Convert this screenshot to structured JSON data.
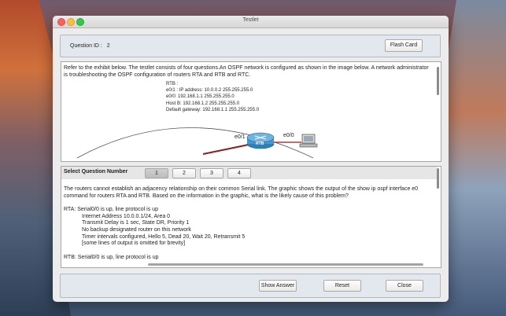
{
  "window": {
    "title": "Testlet"
  },
  "header": {
    "question_id_label": "Question ID :",
    "question_id": "2",
    "flash_card_label": "Flash Card"
  },
  "exhibit": {
    "intro": "Refer to the exhibit below. The testlet consists of four questions.An OSPF network is configured as shown in the image below. A network administrator is troubleshooting the OSPF configuration of routers RTA and RTB and RTC.",
    "info": [
      "RTB :",
      "e0/1 : IP address: 10.0.0.2 255.255.255.0",
      "e0/0: 192.168.1.1 255.255.255.0",
      "Host B: 192.168.1.2 255.255.255.0",
      "Default gateway: 192.168.1.1 255.255.255.0"
    ],
    "port_left": "e0/1",
    "port_right": "e0/0",
    "router_label": "RTB"
  },
  "question": {
    "select_label": "Select Question Number",
    "numbers": [
      "1",
      "2",
      "3",
      "4"
    ],
    "selected": "1",
    "text": "The routers cannot establish an adjacency relationship on their common Serial link. The graphic shows the output of the show ip ospf interface e0 command for routers RTA and RTB. Based on the information in the graphic, what is the likely cause of this problem?",
    "rta_line": "RTA: Serial0/0 is up, line protocol is up",
    "rta_details": [
      "Internet Address 10.0.0.1/24, Area 0",
      "Transmit Delay is 1 sec, State DR, Priority 1",
      "No backup designated router on this network",
      "Timer intervals configured, Hello 5, Dead 20, Wait 20, Retransmit 5",
      "[some lines of output is omitted for brevity]"
    ],
    "rtb_line": "RTB: Serial0/0 is up, line protocol is up"
  },
  "footer": {
    "show_answer": "Show Answer",
    "reset": "Reset",
    "close": "Close"
  },
  "colors": {
    "router": "#2f7fb8",
    "link": "#8b1e1e",
    "panel": "#e3e8ee"
  }
}
